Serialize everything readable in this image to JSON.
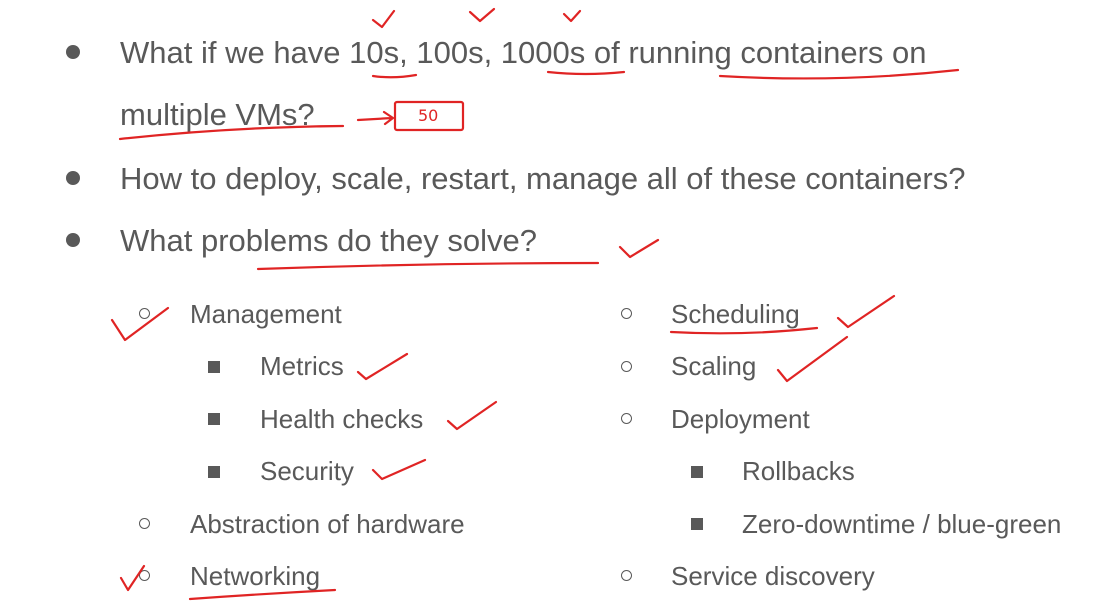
{
  "main_bullets": [
    {
      "line1": "What if we have 10s, 100s, 1000s of running containers on",
      "line2": "multiple VMs?"
    },
    {
      "text": "How to deploy, scale, restart, manage all of these containers?"
    },
    {
      "text": "What problems do they solve?"
    }
  ],
  "left_column": {
    "management": "Management",
    "management_items": [
      "Metrics",
      "Health checks",
      "Security"
    ],
    "abstraction": "Abstraction of hardware",
    "networking": "Networking"
  },
  "right_column": {
    "scheduling": "Scheduling",
    "scaling": "Scaling",
    "deployment": "Deployment",
    "deployment_items": [
      "Rollbacks",
      "Zero-downtime / blue-green"
    ],
    "service_discovery": "Service discovery"
  },
  "annotation": {
    "handwritten_note": "50"
  },
  "colors": {
    "text": "#595959",
    "ink": "#e02424"
  }
}
